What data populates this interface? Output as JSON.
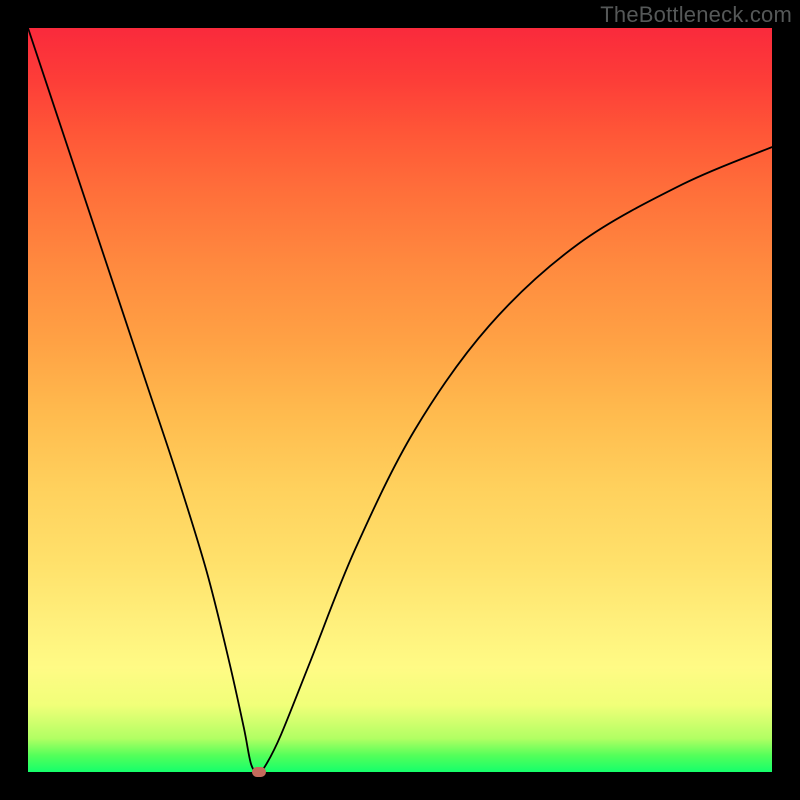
{
  "watermark": "TheBottleneck.com",
  "chart_data": {
    "type": "line",
    "title": "",
    "xlabel": "",
    "ylabel": "",
    "xlim": [
      0,
      100
    ],
    "ylim": [
      0,
      100
    ],
    "series": [
      {
        "name": "curve",
        "x": [
          0,
          4,
          8,
          12,
          16,
          20,
          24,
          27,
          29,
          30,
          31,
          32,
          34,
          38,
          44,
          52,
          62,
          74,
          88,
          100
        ],
        "y": [
          100,
          88,
          76,
          64,
          52,
          40,
          27,
          15,
          6,
          1,
          0,
          1,
          5,
          15,
          30,
          46,
          60,
          71,
          79,
          84
        ]
      }
    ],
    "marker": {
      "x": 31,
      "y": 0,
      "color": "#c46a5c"
    },
    "gradient_stops": [
      {
        "pos": 0.0,
        "color": "#15ff6b"
      },
      {
        "pos": 0.05,
        "color": "#b1ff63"
      },
      {
        "pos": 0.14,
        "color": "#fffb85"
      },
      {
        "pos": 0.48,
        "color": "#ffbb4e"
      },
      {
        "pos": 0.78,
        "color": "#ff6f3a"
      },
      {
        "pos": 1.0,
        "color": "#fa2a3c"
      }
    ]
  }
}
